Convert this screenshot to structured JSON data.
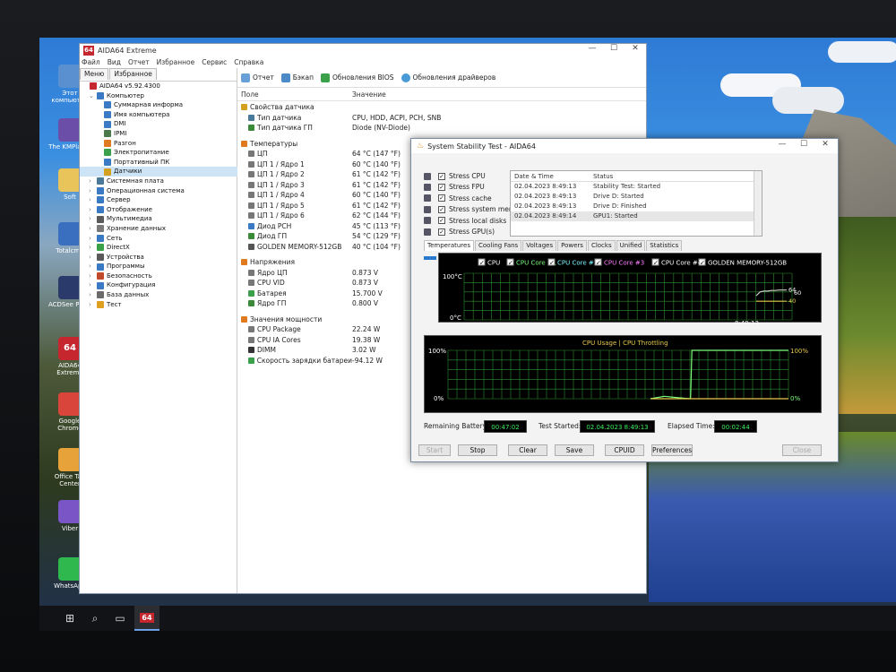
{
  "desktop": {
    "icons": [
      {
        "label": "Этот компьютер",
        "icon": "computer-icon",
        "color": "#5a8fd0"
      },
      {
        "label": "The KMPlayer",
        "icon": "kmplayer-icon",
        "color": "#6a4ea8"
      },
      {
        "label": "Soft",
        "icon": "folder-icon",
        "color": "#e8c45a"
      },
      {
        "label": "Totalcmd",
        "icon": "floppy-icon",
        "color": "#3a6fc0"
      },
      {
        "label": "ACDSee Pro 5",
        "icon": "acdsee-icon",
        "color": "#2a3a6a"
      },
      {
        "label": "AIDA64 Extreme",
        "icon": "aida64-icon",
        "color": "#c6262e",
        "glyph": "64"
      },
      {
        "label": "Google Chrome",
        "icon": "chrome-icon",
        "color": "#d9453a"
      },
      {
        "label": "Office Tab Center",
        "icon": "office-tab-icon",
        "color": "#e8a23a"
      },
      {
        "label": "Viber",
        "icon": "viber-icon",
        "color": "#7a55c6"
      },
      {
        "label": "WhatsApp",
        "icon": "whatsapp-icon",
        "color": "#2fb84e"
      }
    ]
  },
  "taskbar": {
    "items": [
      "windows-icon",
      "search-icon",
      "task-view-icon",
      "aida64-icon"
    ],
    "aida_glyph": "64"
  },
  "aida": {
    "title": "AIDA64 Extreme",
    "logo": "64",
    "controls": [
      "—",
      "☐",
      "✕"
    ],
    "menu": [
      "Файл",
      "Вид",
      "Отчет",
      "Избранное",
      "Сервис",
      "Справка"
    ],
    "left_tabs": [
      "Меню",
      "Избранное"
    ],
    "tree": [
      {
        "label": "AIDA64 v5.92.4300",
        "indent": 0,
        "exp": "",
        "color": "#c6262e"
      },
      {
        "label": "Компьютер",
        "indent": 1,
        "exp": "⌄",
        "color": "#3a79c4"
      },
      {
        "label": "Суммарная информа",
        "indent": 2,
        "exp": "",
        "color": "#3a79c4"
      },
      {
        "label": "Имя компьютера",
        "indent": 2,
        "exp": "",
        "color": "#3a79c4"
      },
      {
        "label": "DMI",
        "indent": 2,
        "exp": "",
        "color": "#3a79c4"
      },
      {
        "label": "IPMI",
        "indent": 2,
        "exp": "",
        "color": "#4a7a4a"
      },
      {
        "label": "Разгон",
        "indent": 2,
        "exp": "",
        "color": "#e07a1f"
      },
      {
        "label": "Электропитание",
        "indent": 2,
        "exp": "",
        "color": "#3aa04a"
      },
      {
        "label": "Портативный ПК",
        "indent": 2,
        "exp": "",
        "color": "#3a79c4"
      },
      {
        "label": "Датчики",
        "indent": 2,
        "exp": "",
        "color": "#d4a11f",
        "sel": true
      },
      {
        "label": "Системная плата",
        "indent": 1,
        "exp": "›",
        "color": "#4a7a9a"
      },
      {
        "label": "Операционная система",
        "indent": 1,
        "exp": "›",
        "color": "#3a79c4"
      },
      {
        "label": "Сервер",
        "indent": 1,
        "exp": "›",
        "color": "#3a79c4"
      },
      {
        "label": "Отображение",
        "indent": 1,
        "exp": "›",
        "color": "#3a79c4"
      },
      {
        "label": "Мультимедиа",
        "indent": 1,
        "exp": "›",
        "color": "#5a5a5a"
      },
      {
        "label": "Хранение данных",
        "indent": 1,
        "exp": "›",
        "color": "#7a7a7a"
      },
      {
        "label": "Сеть",
        "indent": 1,
        "exp": "›",
        "color": "#3a79c4"
      },
      {
        "label": "DirectX",
        "indent": 1,
        "exp": "›",
        "color": "#3aa04a"
      },
      {
        "label": "Устройства",
        "indent": 1,
        "exp": "›",
        "color": "#5a5a5a"
      },
      {
        "label": "Программы",
        "indent": 1,
        "exp": "›",
        "color": "#3a79c4"
      },
      {
        "label": "Безопасность",
        "indent": 1,
        "exp": "›",
        "color": "#c04a2a"
      },
      {
        "label": "Конфигурация",
        "indent": 1,
        "exp": "›",
        "color": "#3a79c4"
      },
      {
        "label": "База данных",
        "indent": 1,
        "exp": "›",
        "color": "#6a6a6a"
      },
      {
        "label": "Тест",
        "indent": 1,
        "exp": "›",
        "color": "#e0a01f"
      }
    ],
    "toolbar": {
      "report": "Отчет",
      "backup": "Бэкап",
      "bios": "Обновления BIOS",
      "drivers": "Обновления драйверов"
    },
    "columns": {
      "field": "Поле",
      "value": "Значение"
    },
    "rows": [
      {
        "type": "sec",
        "field": "Свойства датчика",
        "value": "",
        "color": "#d4a11f"
      },
      {
        "type": "row",
        "field": "Тип датчика",
        "value": "CPU, HDD, ACPI, PCH, SNB",
        "color": "#4a7a9a"
      },
      {
        "type": "row",
        "field": "Тип датчика ГП",
        "value": "Diode  (NV-Diode)",
        "color": "#3a8a3a"
      },
      {
        "type": "gap"
      },
      {
        "type": "sec",
        "field": "Температуры",
        "value": "",
        "color": "#e07a1f"
      },
      {
        "type": "row",
        "field": "ЦП",
        "value": "64 °C  (147 °F)",
        "color": "#777"
      },
      {
        "type": "row",
        "field": "ЦП 1 / Ядро 1",
        "value": "60 °C  (140 °F)",
        "color": "#777"
      },
      {
        "type": "row",
        "field": "ЦП 1 / Ядро 2",
        "value": "61 °C  (142 °F)",
        "color": "#777"
      },
      {
        "type": "row",
        "field": "ЦП 1 / Ядро 3",
        "value": "61 °C  (142 °F)",
        "color": "#777"
      },
      {
        "type": "row",
        "field": "ЦП 1 / Ядро 4",
        "value": "60 °C  (140 °F)",
        "color": "#777"
      },
      {
        "type": "row",
        "field": "ЦП 1 / Ядро 5",
        "value": "61 °C  (142 °F)",
        "color": "#777"
      },
      {
        "type": "row",
        "field": "ЦП 1 / Ядро 6",
        "value": "62 °C  (144 °F)",
        "color": "#777"
      },
      {
        "type": "row",
        "field": "Диод PCH",
        "value": "45 °C  (113 °F)",
        "color": "#3a79c4"
      },
      {
        "type": "row",
        "field": "Диод ГП",
        "value": "54 °C  (129 °F)",
        "color": "#3a8a3a"
      },
      {
        "type": "row",
        "field": "GOLDEN MEMORY-512GB",
        "value": "40 °C  (104 °F)",
        "color": "#555"
      },
      {
        "type": "gap"
      },
      {
        "type": "sec",
        "field": "Напряжения",
        "value": "",
        "color": "#e07a1f"
      },
      {
        "type": "row",
        "field": "Ядро ЦП",
        "value": "0.873 V",
        "color": "#777"
      },
      {
        "type": "row",
        "field": "CPU VID",
        "value": "0.873 V",
        "color": "#777"
      },
      {
        "type": "row",
        "field": "Батарея",
        "value": "15.700 V",
        "color": "#3aa04a"
      },
      {
        "type": "row",
        "field": "Ядро ГП",
        "value": "0.800 V",
        "color": "#3a8a3a"
      },
      {
        "type": "gap"
      },
      {
        "type": "sec",
        "field": "Значения мощности",
        "value": "",
        "color": "#e07a1f"
      },
      {
        "type": "row",
        "field": "CPU Package",
        "value": "22.24 W",
        "color": "#777"
      },
      {
        "type": "row",
        "field": "CPU IA Cores",
        "value": "19.38 W",
        "color": "#777"
      },
      {
        "type": "row",
        "field": "DIMM",
        "value": "3.02 W",
        "color": "#333"
      },
      {
        "type": "row",
        "field": "Скорость зарядки батареи",
        "value": "-94.12 W",
        "color": "#3aa04a"
      }
    ]
  },
  "sst": {
    "title": "System Stability Test - AIDA64",
    "controls": [
      "—",
      "☐",
      "✕"
    ],
    "stress": [
      {
        "label": "Stress CPU",
        "checked": true,
        "icon": "cpu-icon"
      },
      {
        "label": "Stress FPU",
        "checked": true,
        "icon": "fpu-icon"
      },
      {
        "label": "Stress cache",
        "checked": true,
        "icon": "cache-icon"
      },
      {
        "label": "Stress system memory",
        "checked": true,
        "icon": "memory-icon"
      },
      {
        "label": "Stress local disks",
        "checked": true,
        "icon": "disk-icon"
      },
      {
        "label": "Stress GPU(s)",
        "checked": true,
        "icon": "gpu-icon"
      }
    ],
    "log_headers": {
      "date": "Date & Time",
      "status": "Status"
    },
    "log": [
      {
        "date": "02.04.2023 8:49:13",
        "status": "Stability Test: Started"
      },
      {
        "date": "02.04.2023 8:49:13",
        "status": "Drive D: Started"
      },
      {
        "date": "02.04.2023 8:49:13",
        "status": "Drive D: Finished"
      },
      {
        "date": "02.04.2023 8:49:14",
        "status": "GPU1: Started"
      }
    ],
    "tabs": [
      "Temperatures",
      "Cooling Fans",
      "Voltages",
      "Powers",
      "Clocks",
      "Unified",
      "Statistics"
    ],
    "active_tab": "Temperatures",
    "stats": {
      "battery_label": "Remaining Battery:",
      "battery": "00:47:02",
      "started_label": "Test Started:",
      "started": "02.04.2023 8:49:13",
      "elapsed_label": "Elapsed Time:",
      "elapsed": "00:02:44"
    },
    "buttons": {
      "start": "Start",
      "stop": "Stop",
      "clear": "Clear",
      "save": "Save",
      "cpuid": "CPUID",
      "preferences": "Preferences",
      "close": "Close"
    }
  },
  "chart_data": [
    {
      "type": "line",
      "title": "",
      "legend": [
        "CPU",
        "CPU Core #1",
        "CPU Core #2",
        "CPU Core #3",
        "CPU Core #4",
        "GOLDEN MEMORY-512GB"
      ],
      "legend_colors": [
        "#ffffff",
        "#7dff7d",
        "#7df7ff",
        "#ff7dff",
        "#ffffff",
        "#ffffff"
      ],
      "ylim": [
        0,
        100
      ],
      "ytick_labels": [
        "100°C",
        "0°C"
      ],
      "x_label": "8:49:13",
      "series": [
        {
          "name": "CPU",
          "values": [
            52,
            60,
            62,
            62,
            63,
            63,
            64,
            64,
            64
          ],
          "color": "#d0d0d0"
        },
        {
          "name": "GOLDEN MEMORY-512GB",
          "values": [
            40,
            40,
            40,
            40,
            40,
            40,
            40,
            40,
            40
          ],
          "color": "#e6c84a"
        }
      ],
      "end_labels": [
        "64",
        "60",
        "40"
      ]
    },
    {
      "type": "line",
      "title": "CPU Usage | CPU Throttling",
      "title_colors": [
        "#e6c84a",
        "#e6c84a"
      ],
      "ylim": [
        0,
        100
      ],
      "ytick_labels": [
        "100%",
        "0%"
      ],
      "right_tick_labels": [
        "100%",
        "0%"
      ],
      "series": [
        {
          "name": "CPU Usage",
          "values": [
            0,
            5,
            2,
            100,
            100,
            100,
            100,
            100,
            100,
            100,
            100
          ],
          "color": "#7dff7d"
        },
        {
          "name": "CPU Throttling",
          "values": [
            0,
            0,
            0,
            0,
            0,
            0,
            0,
            0,
            0,
            0,
            0
          ],
          "color": "#e6c84a"
        }
      ]
    }
  ]
}
